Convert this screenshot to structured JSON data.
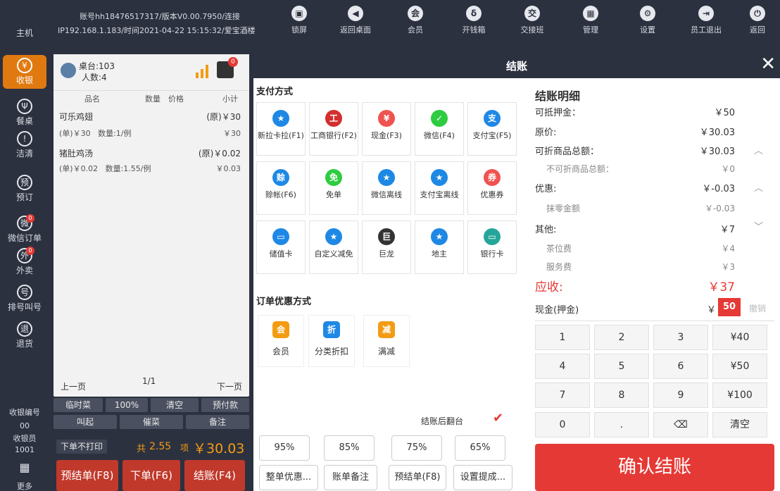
{
  "sidebar": {
    "host_label": "主机",
    "items": [
      {
        "icon": "yen-icon",
        "glyph": "¥",
        "label": "收银"
      },
      {
        "icon": "fork-knife-icon",
        "glyph": "Ψ",
        "label": "餐桌"
      },
      {
        "icon": "warning-icon",
        "glyph": "!",
        "label": "洁清"
      },
      {
        "icon": "reserve-icon",
        "glyph": "预",
        "label": "预订"
      },
      {
        "icon": "wechat-order-icon",
        "glyph": "微",
        "label": "微信订单",
        "badge": "0"
      },
      {
        "icon": "delivery-icon",
        "glyph": "外",
        "label": "外卖",
        "badge": "0"
      },
      {
        "icon": "queue-icon",
        "glyph": "号",
        "label": "排号叫号"
      },
      {
        "icon": "return-icon",
        "glyph": "退",
        "label": "退货"
      }
    ],
    "cashier_no_label": "收银编号",
    "cashier_no": "00",
    "cashier_label": "收银员",
    "cashier": "1001",
    "more_label": "更多"
  },
  "topbar": {
    "info_line1": "账号hh18476517317/版本V0.00.7950/连接",
    "info_line2": "IP192.168.1.183/时间2021-04-22 15:15:32/爱宝酒楼",
    "buttons": [
      {
        "icon": "lock-icon",
        "glyph": "🔒",
        "label": "锁屏"
      },
      {
        "icon": "back-icon",
        "glyph": "◀",
        "label": "返回桌面"
      },
      {
        "icon": "member-icon",
        "glyph": "会",
        "label": "会员"
      },
      {
        "icon": "cash-drawer-icon",
        "glyph": "δ",
        "label": "开钱箱"
      },
      {
        "icon": "handover-icon",
        "glyph": "交",
        "label": "交接班"
      },
      {
        "icon": "manage-icon",
        "glyph": "▦",
        "label": "管理"
      },
      {
        "icon": "settings-icon",
        "glyph": "⚙",
        "label": "设置"
      },
      {
        "icon": "logout-icon",
        "glyph": "⇥",
        "label": "员工退出"
      },
      {
        "icon": "power-icon",
        "glyph": "⏻",
        "label": "返回"
      }
    ]
  },
  "order": {
    "table": "桌台:103",
    "persons": "人数:4",
    "print_badge": "0",
    "col_name": "品名",
    "col_qty": "数量",
    "col_price": "价格",
    "col_subtotal": "小计",
    "items": [
      {
        "name": "可乐鸡翅",
        "orig": "(原)￥30",
        "unit": "(单)￥30",
        "qty": "数量:1/例",
        "subtotal": "￥30"
      },
      {
        "name": "猪肚鸡汤",
        "orig": "(原)￥0.02",
        "unit": "(单)￥0.02",
        "qty": "数量:1.55/例",
        "subtotal": "￥0.03"
      }
    ],
    "prev_page": "上一页",
    "page": "1/1",
    "next_page": "下一页",
    "btn_row1": [
      "临时菜",
      "100%",
      "清空",
      "预付款"
    ],
    "btn_row2": [
      "叫起",
      "催菜",
      "备注"
    ],
    "no_print": "下单不打印",
    "total_prefix": "共",
    "total_qty": "2.55",
    "total_unit": "项",
    "total_amount": "￥30.03",
    "pre_checkout": "预结单(F8)",
    "place_order": "下单(F6)",
    "checkout": "结账(F4)"
  },
  "dialog": {
    "title": "结账",
    "pay_section": "支付方式",
    "pay_methods": [
      {
        "icon": "star-icon",
        "glyph": "★",
        "color": "#1e88e5",
        "label": "新拉卡拉(F1)"
      },
      {
        "icon": "icbc-icon",
        "glyph": "工",
        "color": "#d32f2f",
        "label": "工商银行(F2)"
      },
      {
        "icon": "cash-yen-icon",
        "glyph": "¥",
        "color": "#ef5350",
        "label": "现金(F3)"
      },
      {
        "icon": "wechat-icon",
        "glyph": "✓",
        "color": "#2ecc40",
        "label": "微信(F4)"
      },
      {
        "icon": "alipay-icon",
        "glyph": "支",
        "color": "#1e88e5",
        "label": "支付宝(F5)"
      },
      {
        "icon": "credit-icon",
        "glyph": "赊",
        "color": "#1e88e5",
        "label": "赊帐(F6)"
      },
      {
        "icon": "free-icon",
        "glyph": "免",
        "color": "#2ecc40",
        "label": "免单"
      },
      {
        "icon": "star-icon",
        "glyph": "★",
        "color": "#1e88e5",
        "label": "微信离线"
      },
      {
        "icon": "star-icon",
        "glyph": "★",
        "color": "#1e88e5",
        "label": "支付宝离线"
      },
      {
        "icon": "coupon-icon",
        "glyph": "券",
        "color": "#ef5350",
        "label": "优惠券"
      },
      {
        "icon": "stored-card-icon",
        "glyph": "▭",
        "color": "#1e88e5",
        "label": "储值卡"
      },
      {
        "icon": "star-icon",
        "glyph": "★",
        "color": "#1e88e5",
        "label": "自定义减免"
      },
      {
        "icon": "julong-icon",
        "glyph": "巨",
        "color": "#333333",
        "label": "巨龙"
      },
      {
        "icon": "star-icon",
        "glyph": "★",
        "color": "#1e88e5",
        "label": "地主"
      },
      {
        "icon": "bank-card-icon",
        "glyph": "▭",
        "color": "#26a69a",
        "label": "银行卡"
      }
    ],
    "discount_section": "订单优惠方式",
    "discounts": [
      {
        "icon": "member-discount-icon",
        "glyph": "会",
        "color": "#f39c12",
        "label": "会员"
      },
      {
        "icon": "category-discount-icon",
        "glyph": "折",
        "color": "#1e88e5",
        "label": "分类折扣"
      },
      {
        "icon": "full-reduction-icon",
        "glyph": "减",
        "color": "#f39c12",
        "label": "满减"
      }
    ],
    "turnover_label": "结账后翻台",
    "percents": [
      "95%",
      "85%",
      "75%",
      "65%"
    ],
    "bottom_btns": [
      "整单优惠...",
      "账单备注",
      "预结单(F8)",
      "设置提成..."
    ]
  },
  "detail": {
    "title": "结账明细",
    "deposit_label": "可抵押金：",
    "deposit": "￥50",
    "orig_label": "原价:",
    "orig": "￥30.03",
    "discountable_label": "可折商品总额：",
    "discountable": "￥30.03",
    "nondiscountable_label": "不可折商品总额：",
    "nondiscountable": "￥0",
    "discount_label": "优惠:",
    "discount": "￥-0.03",
    "rounding_label": "抹零金额",
    "rounding": "￥-0.03",
    "other_label": "其他:",
    "other": "￥7",
    "tea_label": "茶位费",
    "tea": "￥4",
    "service_label": "服务费",
    "service": "￥3",
    "due_label": "应收:",
    "due": "￥37",
    "cash_label": "现金(押金)",
    "cash_prefix": "￥",
    "cash_value": "50",
    "cancel": "撤销",
    "keys": [
      "1",
      "2",
      "3",
      "¥40",
      "4",
      "5",
      "6",
      "¥50",
      "7",
      "8",
      "9",
      "¥100",
      "0",
      ".",
      "",
      "清空"
    ],
    "confirm": "确认结账"
  }
}
